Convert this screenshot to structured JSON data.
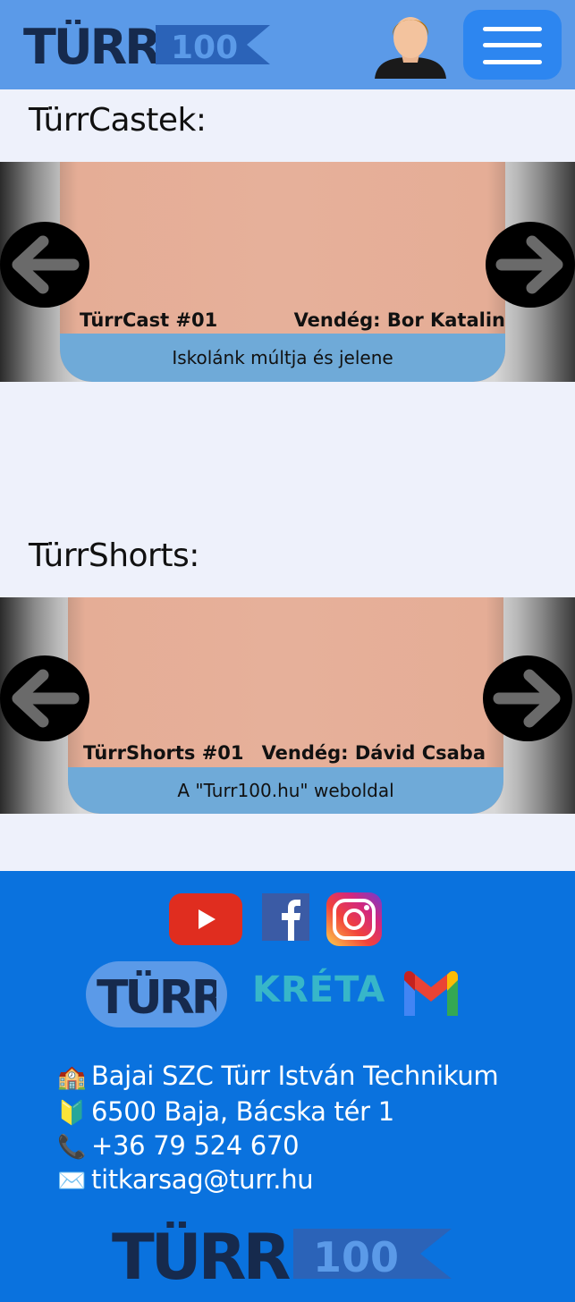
{
  "header": {
    "logo_text": "TÜRR",
    "logo_number": "100"
  },
  "sections": {
    "castek_title": "TürrCastek:",
    "shorts_title": "TürrShorts:"
  },
  "cast": {
    "episode": "TürrCast #01",
    "guest": "Vendég: Bor Katalin",
    "caption": "Iskolánk múltja és jelene"
  },
  "shorts": {
    "episode": "TürrShorts #01",
    "guest": "Vendég: Dávid Csaba",
    "caption": "A \"Turr100.hu\" weboldal"
  },
  "footer": {
    "turr_logo_text": "TÜRR",
    "kreta_text": "KRÉTA",
    "contacts": [
      {
        "icon": "🏫",
        "text": "Bajai SZC Türr István Technikum"
      },
      {
        "icon": "🔰",
        "text": "6500 Baja, Bácska tér 1"
      },
      {
        "icon": "📞",
        "text": "+36 79 524 670"
      },
      {
        "icon": "✉️",
        "text": "titkarsag@turr.hu"
      }
    ],
    "big_logo_text": "TÜRR",
    "big_logo_number": "100"
  },
  "colors": {
    "header_bg": "#5b9ae8",
    "menu_button": "#2d86f0",
    "footer_bg": "#0a72de",
    "page_bg": "#eef1fb",
    "logo_dark": "#162a4d",
    "slide_caption": "#6faad8",
    "kreta": "#37b6c9"
  },
  "icons": [
    "turr100-logo",
    "user-avatar-icon",
    "hamburger-menu-icon",
    "arrow-left-icon",
    "arrow-right-icon",
    "youtube-icon",
    "facebook-icon",
    "instagram-icon",
    "turr-logo",
    "kreta-logo",
    "gmail-icon"
  ]
}
